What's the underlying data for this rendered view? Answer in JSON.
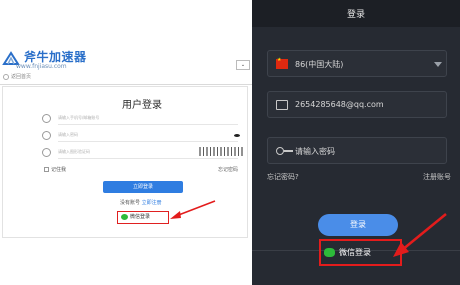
{
  "left": {
    "logo_name": "斧牛加速器",
    "logo_url": "www.fnjiasu.com",
    "back_label": "返回首页",
    "title": "用户登录",
    "fields": [
      {
        "icon": "user-icon",
        "placeholder": "请输入手机号/邮箱账号"
      },
      {
        "icon": "lock-icon",
        "placeholder": "请输入密码"
      },
      {
        "icon": "shield-icon",
        "placeholder": "请输入图形验证码"
      }
    ],
    "remember_label": "记住我",
    "forgot_label": "忘记密码",
    "login_label": "立即登录",
    "register_prompt": "没有账号",
    "register_link": "立即注册",
    "wechat_label": "微信登录"
  },
  "right": {
    "title": "登录",
    "country_code": "86(中国大陆)",
    "account_value": "2654285648@qq.com",
    "password_placeholder": "请输入密码",
    "forgot_label": "忘记密码?",
    "register_label": "注册账号",
    "login_label": "登录",
    "wechat_label": "微信登录"
  },
  "colors": {
    "brand_blue": "#2f7de1",
    "dark_bg": "#262a32",
    "highlight_red": "#e31c1c",
    "wechat_green": "#2dbb3a"
  }
}
